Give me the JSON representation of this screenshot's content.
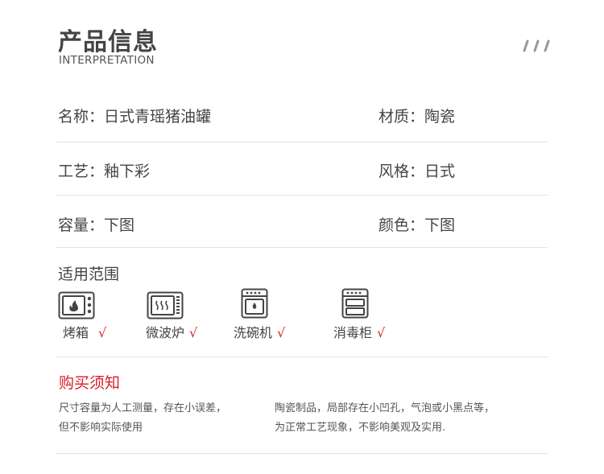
{
  "header": {
    "title": "产品信息",
    "subtitle": "INTERPRETATION"
  },
  "specs": {
    "name": "名称：日式青瑶猪油罐",
    "material": "材质：陶瓷",
    "craft": "工艺：釉下彩",
    "style": "风格：日式",
    "capacity": "容量：下图",
    "color": "颜色：下图"
  },
  "applicable": {
    "label": "适用范围",
    "items": [
      {
        "label": "烤箱",
        "icon": "oven-icon",
        "check": "√"
      },
      {
        "label": "微波炉",
        "icon": "microwave-icon",
        "check": "√"
      },
      {
        "label": "洗碗机",
        "icon": "dishwasher-icon",
        "check": "√"
      },
      {
        "label": "消毒柜",
        "icon": "sterilizer-icon",
        "check": "√"
      }
    ]
  },
  "notice": {
    "title": "购买须知",
    "left_lines": [
      "尺寸容量为人工测量，存在小误差，",
      "但不影响实际使用"
    ],
    "right_lines": [
      "陶瓷制品，局部存在小凹孔，气泡或小黑点等，",
      "为正常工艺现象，不影响美观及实用."
    ]
  },
  "colors": {
    "accent": "#d81e2a",
    "text": "#444444",
    "divider": "#e3e3e3"
  }
}
